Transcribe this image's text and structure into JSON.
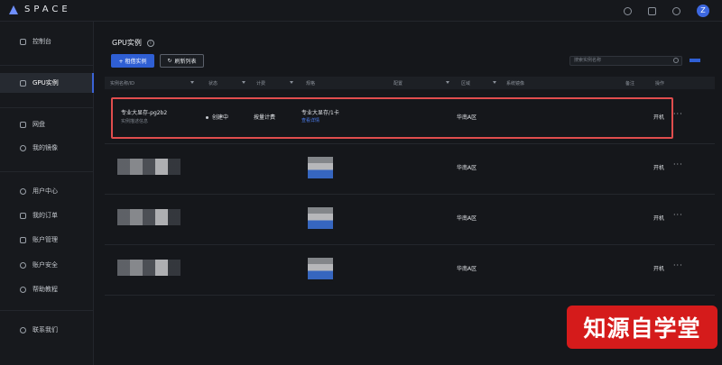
{
  "app": {
    "brand": "SPACE",
    "avatar_letter": "Z"
  },
  "sidebar": {
    "items": [
      {
        "label": "控制台",
        "icon": "home-icon"
      },
      {
        "label": "GPU实例",
        "icon": "gpu-icon"
      },
      {
        "label": "网盘",
        "icon": "disk-icon"
      },
      {
        "label": "我的镜像",
        "icon": "image-icon"
      },
      {
        "label": "用户中心",
        "icon": "user-icon"
      },
      {
        "label": "我的订单",
        "icon": "order-icon"
      },
      {
        "label": "账户管理",
        "icon": "account-icon"
      },
      {
        "label": "账户安全",
        "icon": "shield-icon"
      },
      {
        "label": "帮助教程",
        "icon": "help-icon"
      },
      {
        "label": "联系我们",
        "icon": "contact-icon"
      }
    ]
  },
  "main": {
    "title": "GPU实例",
    "create_button": "+ 租借实例",
    "refresh_button": "刷新列表",
    "search_placeholder": "搜索实例名称",
    "columns": [
      "实例名称/ID",
      "状态",
      "计费",
      "规格",
      "配置",
      "区域",
      "系统镜像",
      "备注",
      "操作"
    ],
    "rows": [
      {
        "name": "专业大显存-pg2b2",
        "sub": "实例描述信息",
        "status": "创建中",
        "billing": "按量计费",
        "spec": "专业大显存/1卡",
        "spec_link": "查看详情",
        "region": "华南A区",
        "action": "开机",
        "more": "···"
      },
      {
        "region": "华南A区",
        "action": "开机",
        "more": "···"
      },
      {
        "region": "华南A区",
        "action": "开机",
        "more": "···"
      },
      {
        "region": "华南A区",
        "action": "开机",
        "more": "···"
      }
    ]
  },
  "watermark": "知源自学堂",
  "colors": {
    "accent": "#2f5fd4",
    "highlight": "#e04d4d",
    "watermark_bg": "#d51b1b"
  }
}
